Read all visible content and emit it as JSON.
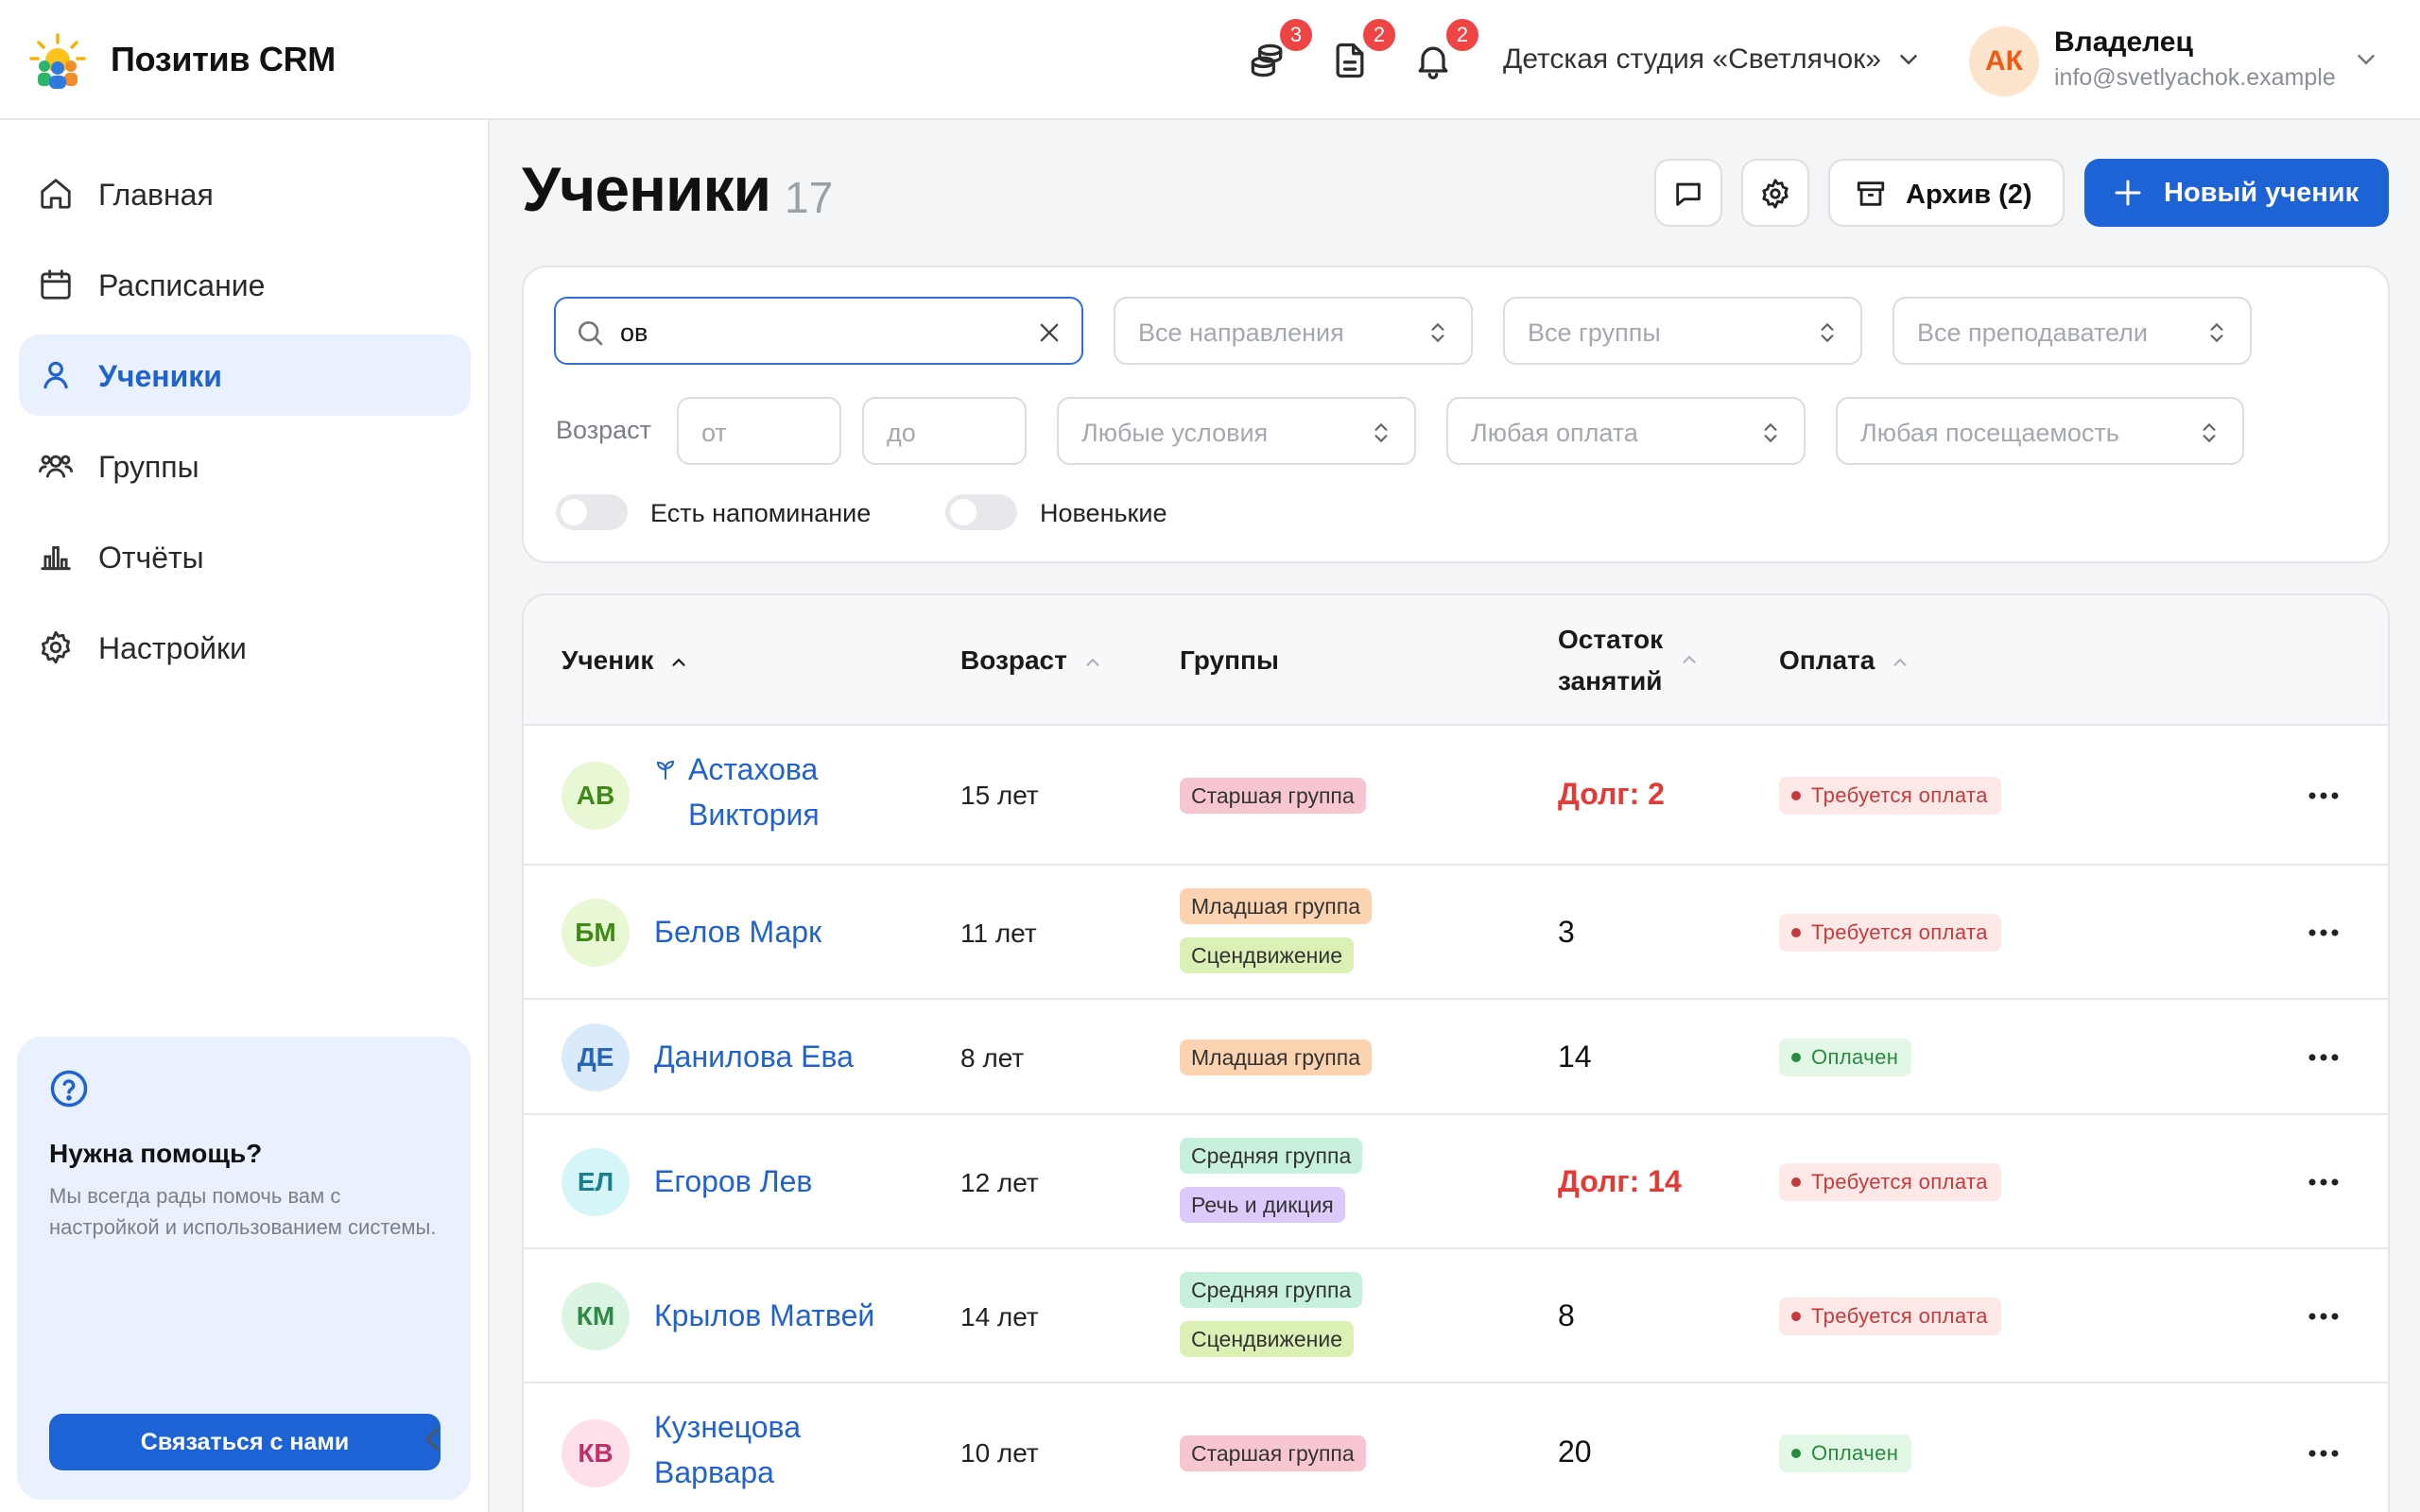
{
  "header": {
    "app_title": "Позитив CRM",
    "badges": {
      "payments": "3",
      "documents": "2",
      "notifications": "2"
    },
    "org_name": "Детская студия «Светлячок»",
    "user": {
      "initials": "АК",
      "role": "Владелец",
      "email": "info@svetlyachok.example"
    }
  },
  "sidebar": {
    "items": [
      {
        "label": "Главная",
        "icon": "home-icon"
      },
      {
        "label": "Расписание",
        "icon": "calendar-icon"
      },
      {
        "label": "Ученики",
        "icon": "user-icon",
        "active": true
      },
      {
        "label": "Группы",
        "icon": "users-icon"
      },
      {
        "label": "Отчёты",
        "icon": "chart-icon"
      },
      {
        "label": "Настройки",
        "icon": "gear-icon"
      }
    ],
    "help": {
      "title": "Нужна помощь?",
      "text": "Мы всегда рады помочь вам с настройкой и использованием системы.",
      "button": "Связаться с нами"
    }
  },
  "page": {
    "title": "Ученики",
    "count": "17",
    "archive_label": "Архив (2)",
    "new_label": "Новый ученик"
  },
  "filters": {
    "search_value": "ов",
    "directions": "Все направления",
    "groups": "Все группы",
    "teachers": "Все преподаватели",
    "age_label": "Возраст",
    "age_from": "от",
    "age_to": "до",
    "conditions": "Любые условия",
    "payment": "Любая оплата",
    "attendance": "Любая посещаемость",
    "toggle_reminder": "Есть напоминание",
    "toggle_new": "Новенькие"
  },
  "table": {
    "headers": {
      "student": "Ученик",
      "age": "Возраст",
      "groups": "Группы",
      "remaining_1": "Остаток",
      "remaining_2": "занятий",
      "payment": "Оплата"
    },
    "rows": [
      {
        "initials": "АВ",
        "name_1": "Астахова",
        "name_2": "Виктория",
        "age": "15 лет",
        "groups": [
          "Старшая группа"
        ],
        "remaining": "Долг: 2",
        "payment": "Требуется оплата"
      },
      {
        "initials": "БМ",
        "name_1": "Белов Марк",
        "age": "11 лет",
        "groups": [
          "Младшая группа",
          "Сцендвижение"
        ],
        "remaining": "3",
        "payment": "Требуется оплата"
      },
      {
        "initials": "ДЕ",
        "name_1": "Данилова Ева",
        "age": "8 лет",
        "groups": [
          "Младшая группа"
        ],
        "remaining": "14",
        "payment": "Оплачен"
      },
      {
        "initials": "ЕЛ",
        "name_1": "Егоров Лев",
        "age": "12 лет",
        "groups": [
          "Средняя группа",
          "Речь и дикция"
        ],
        "remaining": "Долг: 14",
        "payment": "Требуется оплата"
      },
      {
        "initials": "КМ",
        "name_1": "Крылов Матвей",
        "age": "14 лет",
        "groups": [
          "Средняя группа",
          "Сцендвижение"
        ],
        "remaining": "8",
        "payment": "Требуется оплата"
      },
      {
        "initials": "КВ",
        "name_1": "Кузнецова",
        "name_2": "Варвара",
        "age": "10 лет",
        "groups": [
          "Старшая группа"
        ],
        "remaining": "20",
        "payment": "Оплачен"
      }
    ]
  },
  "colors": {
    "accent": "#1e63d6",
    "debt": "#e53935",
    "tag_senior": "#f7c6d0",
    "tag_junior": "#fbd3b0",
    "tag_movement": "#dbf0b5",
    "tag_middle": "#c7f1dc",
    "tag_speech": "#dccafb"
  }
}
